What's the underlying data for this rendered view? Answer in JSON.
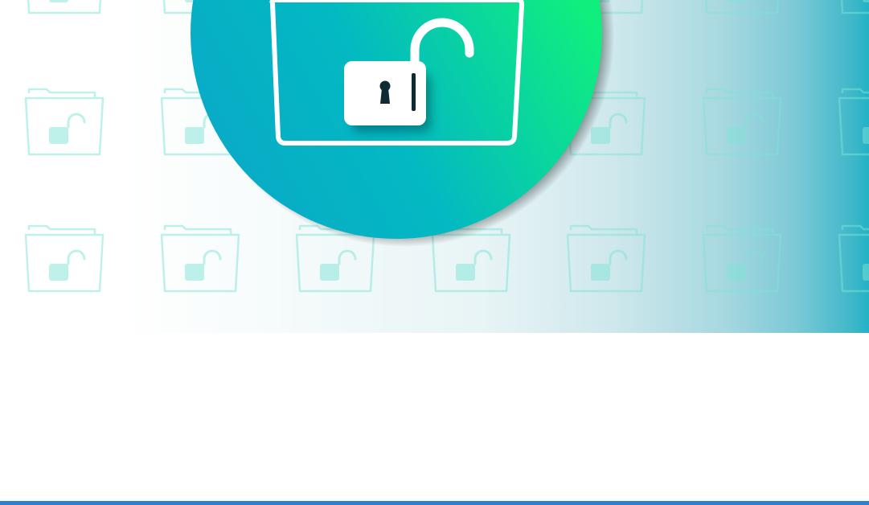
{
  "illustration": {
    "subject": "unlocked-folder",
    "icons": [
      "folder-unlock-icon",
      "folder-icon",
      "open-padlock-icon",
      "keyhole-icon"
    ],
    "colors": {
      "badge_gradient_start": "#0aa6c8",
      "badge_gradient_end": "#10ef7e",
      "pattern_icon": "#7fe3d6",
      "banner_right_edge": "#22b2c6",
      "accent_bar": "#2f7fd0",
      "background": "#ffffff"
    }
  }
}
